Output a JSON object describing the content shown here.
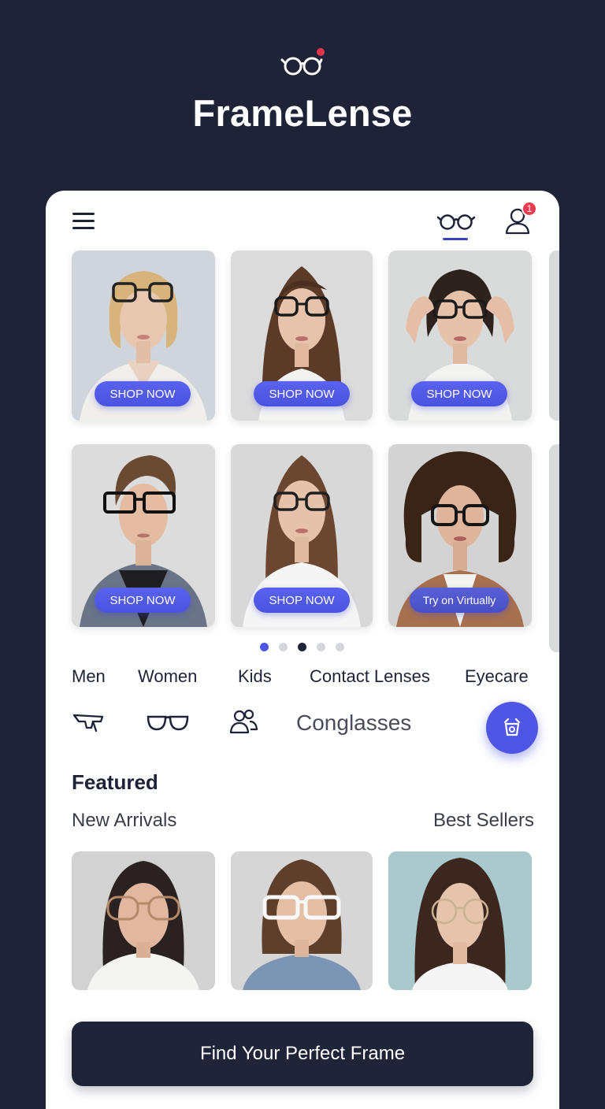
{
  "brand": {
    "name": "FrameLense",
    "logo_icon": "glasses-logo-icon",
    "accent": "#e8344a"
  },
  "topbar": {
    "menu_icon": "hamburger-icon",
    "active_tab_icon": "glasses-icon",
    "profile_icon": "user-icon",
    "notification_count": "1"
  },
  "gallery": {
    "row1": [
      {
        "label": "SHOP NOW"
      },
      {
        "label": "SHOP NOW"
      },
      {
        "label": "SHOP NOW"
      }
    ],
    "row2": [
      {
        "label": "SHOP NOW"
      },
      {
        "label": "SHOP NOW"
      },
      {
        "label": "Try on Virtually"
      }
    ],
    "pagination": {
      "count": 5,
      "active": 3
    }
  },
  "categories": [
    "Men",
    "Women",
    "Kids",
    "Contact Lenses",
    "Eyecare"
  ],
  "category_icons": {
    "icons": [
      "sunglasses-frame-icon",
      "eyeglasses-icon",
      "users-icon"
    ],
    "label": "Conglasses",
    "fab_icon": "virtual-try-on-icon"
  },
  "featured": {
    "title": "Featured",
    "left_link": "New Arrivals",
    "right_link": "Best Sellers"
  },
  "cta": {
    "label": "Find Your Perfect Frame"
  },
  "colors": {
    "background": "#1e2338",
    "primary": "#4f56e6",
    "button_dark": "#1f2438"
  }
}
